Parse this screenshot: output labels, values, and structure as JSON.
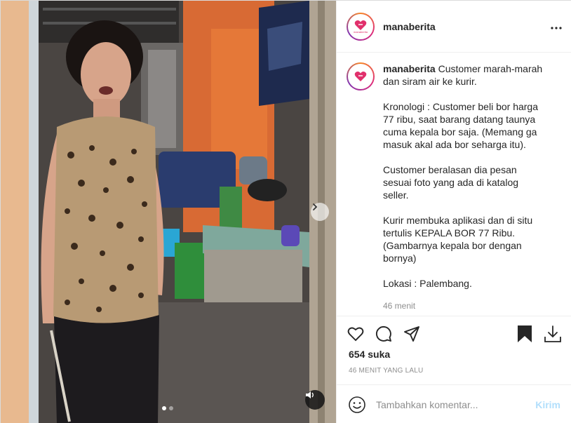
{
  "post": {
    "username": "manaberita",
    "avatar_label": "manaberita",
    "more_icon": "more-horizontal-icon"
  },
  "caption": {
    "username": "manaberita",
    "lines": [
      "Customer marah-marah dan siram air ke kurir.",
      "Kronologi : Customer beli bor harga 77 ribu, saat barang datang taunya cuma kepala bor saja. (Memang ga masuk akal ada bor seharga itu).",
      "Customer beralasan dia pesan sesuai foto yang ada di katalog seller.",
      "Kurir membuka aplikasi dan di situ tertulis KEPALA BOR 77 Ribu. (Gambarnya kepala bor dengan bornya)",
      "Lokasi : Palembang."
    ],
    "time": "46 menit"
  },
  "actions": {
    "likes": "654 suka",
    "ago": "46 MENIT YANG LALU"
  },
  "comment": {
    "placeholder": "Tambahkan komentar...",
    "send_label": "Kirim"
  },
  "media": {
    "slides_total": 2,
    "active_slide": 1
  },
  "colors": {
    "send_disabled": "#b2dffc",
    "secondary_text": "#8e8e8e",
    "brand_pink": "#e1306c"
  }
}
